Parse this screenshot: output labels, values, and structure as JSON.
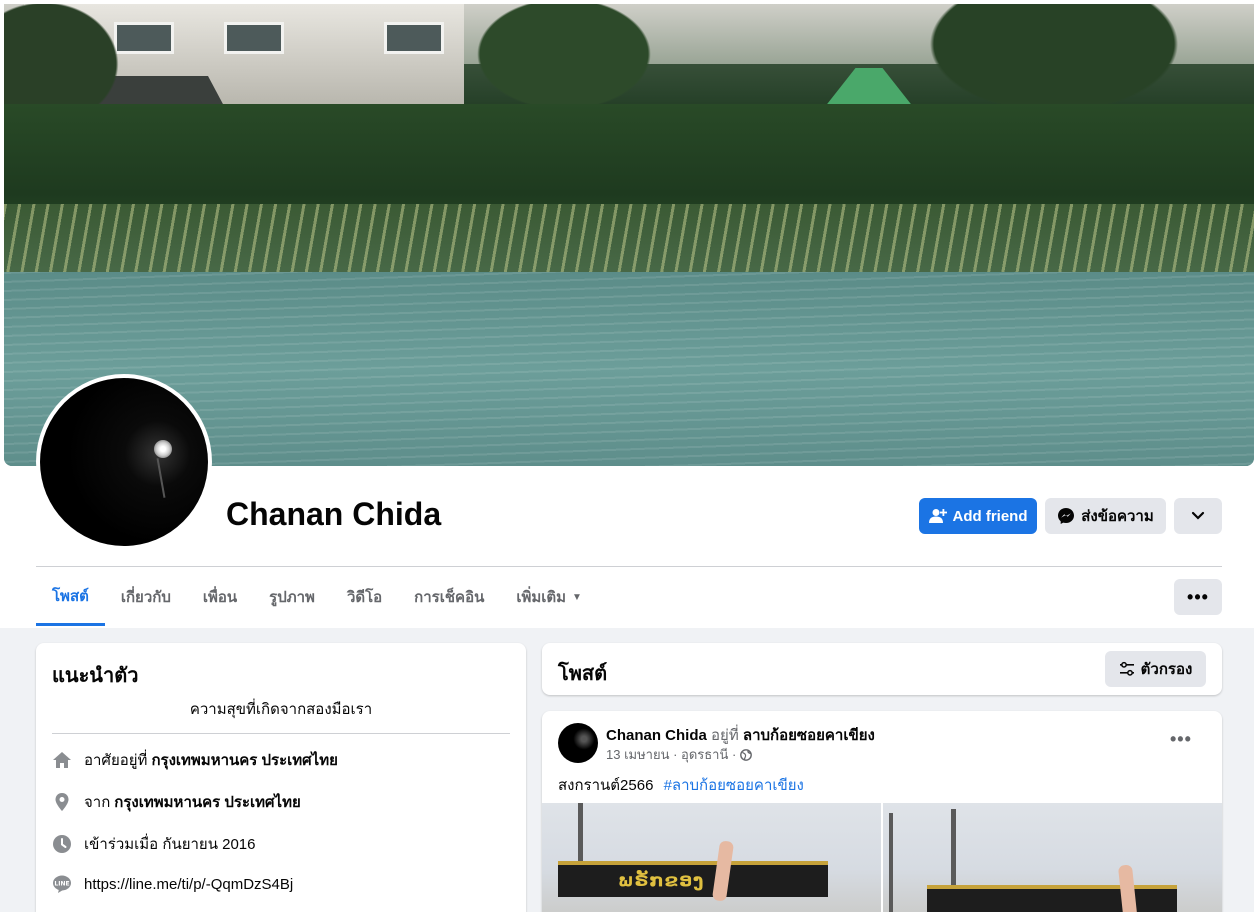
{
  "profile": {
    "name": "Chanan Chida",
    "add_friend_label": "Add friend",
    "message_label": "ส่งข้อความ"
  },
  "tabs": [
    {
      "label": "โพสต์",
      "active": true
    },
    {
      "label": "เกี่ยวกับ"
    },
    {
      "label": "เพื่อน"
    },
    {
      "label": "รูปภาพ"
    },
    {
      "label": "วิดีโอ"
    },
    {
      "label": "การเช็คอิน"
    },
    {
      "label": "เพิ่มเติม"
    }
  ],
  "intro": {
    "title": "แนะนำตัว",
    "bio": "ความสุขที่เกิดจากสองมือเรา",
    "lives_prefix": "อาศัยอยู่ที่",
    "lives_value": "กรุงเทพมหานคร ประเทศไทย",
    "from_prefix": "จาก",
    "from_value": "กรุงเทพมหานคร ประเทศไทย",
    "joined": "เข้าร่วมเมื่อ กันยายน 2016",
    "line_url": "https://line.me/ti/p/-QqmDzS4Bj"
  },
  "posts": {
    "title": "โพสต์",
    "filter_label": "ตัวกรอง"
  },
  "post": {
    "author": "Chanan Chida",
    "at_text": "อยู่ที่",
    "location": "ลาบก้อยซอยคาเขียง",
    "date": "13 เมษายน · อุดรธานี ·",
    "text": "สงกรานต์2566",
    "hashtag": "#ลาบก้อยซอยคาเขียง",
    "photo_sign_1": "ພຣັກຂອງ",
    "photo_sign_2": ""
  },
  "colors": {
    "accent": "#1b74e4",
    "secondary_button": "#e4e6eb",
    "page_bg": "#f0f2f5"
  }
}
